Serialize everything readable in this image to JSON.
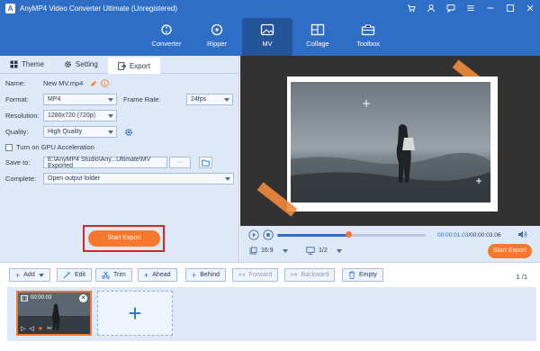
{
  "window": {
    "title": "AnyMP4 Video Converter Ultimate (Unregistered)",
    "controls": [
      "cart-icon",
      "user-icon",
      "chat-icon",
      "menu-icon",
      "minimize-icon",
      "maximize-icon",
      "close-icon"
    ]
  },
  "nav": {
    "items": [
      {
        "label": "Converter",
        "icon": "converter-icon"
      },
      {
        "label": "Ripper",
        "icon": "ripper-icon"
      },
      {
        "label": "MV",
        "icon": "mv-icon",
        "active": true
      },
      {
        "label": "Collage",
        "icon": "collage-icon"
      },
      {
        "label": "Toolbox",
        "icon": "toolbox-icon"
      }
    ]
  },
  "tabs": [
    {
      "label": "Theme",
      "icon": "theme-icon"
    },
    {
      "label": "Setting",
      "icon": "gear-icon"
    },
    {
      "label": "Export",
      "icon": "export-icon",
      "active": true
    }
  ],
  "export": {
    "name_label": "Name:",
    "name_value": "New MV.mp4",
    "format_label": "Format:",
    "format_value": "MP4",
    "frame_rate_label": "Frame Rate:",
    "frame_rate_value": "24fps",
    "resolution_label": "Resolution:",
    "resolution_value": "1280x720 (720p)",
    "quality_label": "Quality:",
    "quality_value": "High Quality",
    "gpu_label": "Turn on GPU Acceleration",
    "gpu_checked": false,
    "save_label": "Save to:",
    "save_value": "E:\\AnyMP4 Studio\\Any...Ultimate\\MV Exported",
    "browse_label": "···",
    "complete_label": "Complete:",
    "complete_value": "Open output folder",
    "start_label": "Start Export"
  },
  "player": {
    "current_time": "00:00:01.03",
    "total_time": "/00:00:03.06",
    "progress": 0.48,
    "aspect": "16:9",
    "zoom": "1/2",
    "start_label": "Start Export"
  },
  "toolbar": {
    "add_label": "Add",
    "edit_label": "Edit",
    "trim_label": "Trim",
    "ahead_label": "Ahead",
    "behind_label": "Behind",
    "forward_label": "Forward",
    "backward_label": "Backward",
    "empty_label": "Empty",
    "page": "1 /1"
  },
  "clip": {
    "duration": "00:00:03"
  },
  "colors": {
    "brand_blue": "#2f6ec6",
    "accent_orange": "#f5782d",
    "highlight_red": "#d7262b"
  }
}
